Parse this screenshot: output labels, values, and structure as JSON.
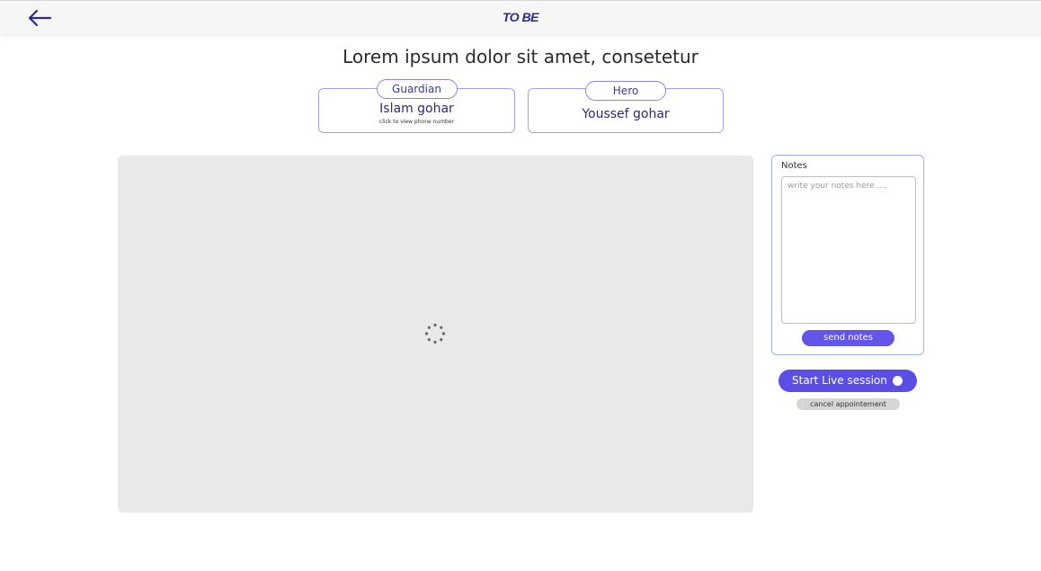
{
  "header": {
    "back_icon": "arrow-left-icon",
    "brand": "TO BE",
    "brand_color": "#2b2b8a"
  },
  "headline": "Lorem ipsum dolor sit amet, consetetur",
  "guardian": {
    "role": "Guardian",
    "name": "Islam gohar",
    "hint": "click to view phone number"
  },
  "hero": {
    "role": "Hero",
    "name": "Youssef gohar"
  },
  "video": {
    "loading_icon": "spinner-icon"
  },
  "notes": {
    "title": "Notes",
    "placeholder": "write your notes here ....",
    "value": "",
    "send_label": "send notes"
  },
  "session": {
    "start_label": "Start Live session",
    "cancel_label": "cancel appointement",
    "accent_color": "#5b4ee8"
  }
}
